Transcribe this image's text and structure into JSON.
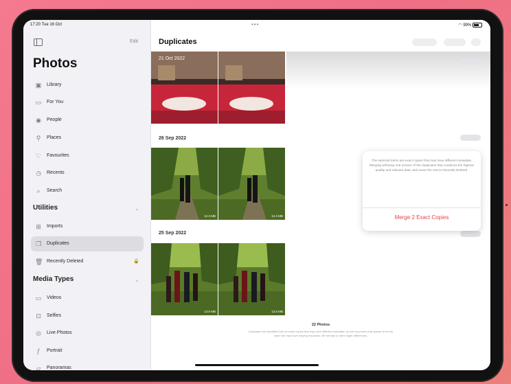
{
  "status": {
    "time": "17:20  Tue 16 Oct",
    "battery": "99%"
  },
  "sidebar": {
    "edit_label": "Edit",
    "title": "Photos",
    "items": [
      {
        "label": "Library",
        "icon": "library-icon"
      },
      {
        "label": "For You",
        "icon": "for-you-icon"
      },
      {
        "label": "People",
        "icon": "people-icon"
      },
      {
        "label": "Places",
        "icon": "places-icon"
      },
      {
        "label": "Favourites",
        "icon": "heart-icon"
      },
      {
        "label": "Recents",
        "icon": "clock-icon"
      },
      {
        "label": "Search",
        "icon": "search-icon"
      }
    ],
    "utilities_header": "Utilities",
    "utilities": [
      {
        "label": "Imports",
        "icon": "imports-icon"
      },
      {
        "label": "Duplicates",
        "icon": "duplicates-icon",
        "selected": true
      },
      {
        "label": "Recently Deleted",
        "icon": "trash-icon",
        "locked": true
      }
    ],
    "media_header": "Media Types",
    "media": [
      {
        "label": "Videos",
        "icon": "video-icon"
      },
      {
        "label": "Selfies",
        "icon": "selfie-icon"
      },
      {
        "label": "Live Photos",
        "icon": "live-photo-icon"
      },
      {
        "label": "Portrait",
        "icon": "portrait-icon"
      },
      {
        "label": "Panoramas",
        "icon": "panorama-icon"
      }
    ]
  },
  "main": {
    "title": "Duplicates",
    "groups": [
      {
        "date": "21 Oct 2022",
        "sizes": [
          "",
          ""
        ]
      },
      {
        "date": "26 Sep 2022",
        "sizes": [
          "12.3 MB",
          "12.3 MB"
        ]
      },
      {
        "date": "25 Sep 2022",
        "sizes": [
          "13.5 MB",
          "13.5 MB"
        ]
      }
    ],
    "popover": {
      "message": "The selected items are exact copies that may have different metadata. Merging will keep one version of the duplicates that combines the highest quality and relevant data, and move the rest to Recently Deleted.",
      "action": "Merge 2 Exact Copies"
    },
    "footer": {
      "count": "22 Photos",
      "description": "Duplicates are identified both as exact copies that may have different metadata, as well as photos that appear to be the same but may have varying resolution, file formats or other slight differences."
    }
  },
  "colors": {
    "accent": "#e0454d",
    "sidebar_bg": "#f2f2f6",
    "background": "#ef7388"
  }
}
